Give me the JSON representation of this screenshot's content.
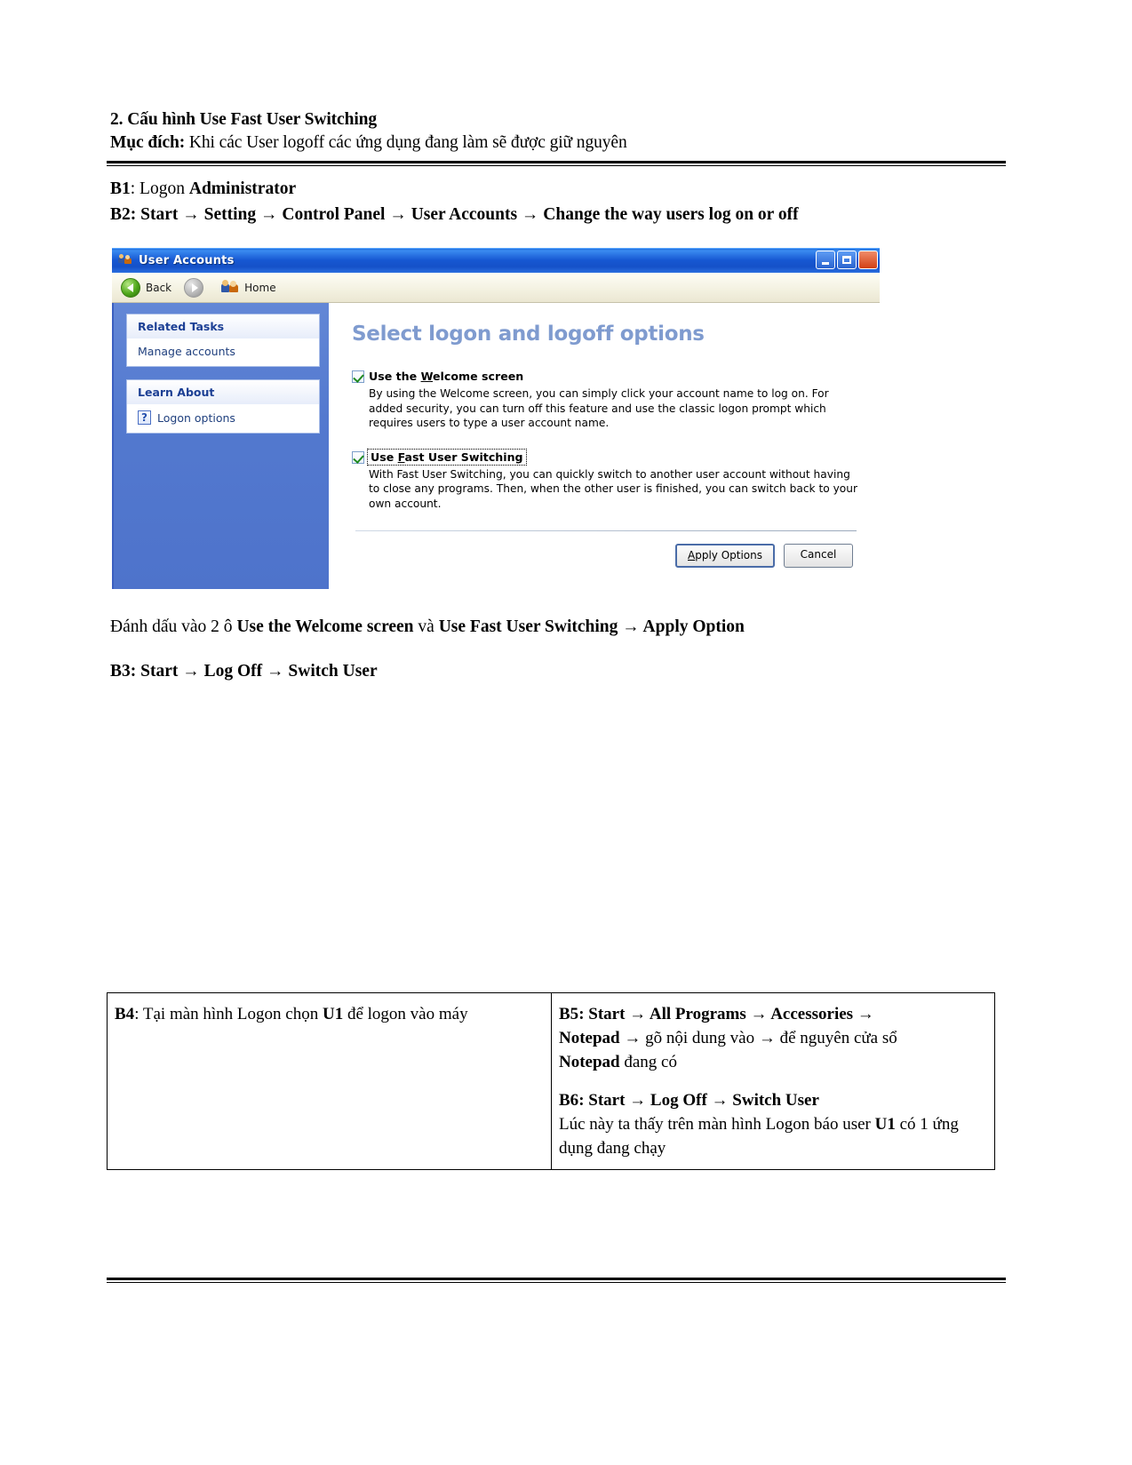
{
  "document": {
    "heading_title": "2. Cấu hình Use Fast User Switching",
    "heading_purpose_label": "Mục đích:",
    "heading_purpose_text": " Khi các User logoff các ứng dụng đang làm sẽ được giữ nguyên",
    "steps": {
      "b1_label": "B1",
      "b1_text": ": Logon ",
      "b1_bold": "Administrator",
      "b2_label": "B2",
      "b2_text": ": Start → Setting → Control Panel → User Accounts → Change the way users log on or off"
    },
    "caption_paragraph": {
      "lead": "Đánh dấu vào 2 ô ",
      "bold1": "Use the Welcome screen",
      "mid": " và ",
      "bold2": "Use Fast User Switching → Apply Option"
    },
    "step_b3": {
      "label": "B3",
      "text": ": Start → Log Off → Switch User"
    }
  },
  "xp_window": {
    "title": "User Accounts",
    "title_icon": "users-icon",
    "caption_buttons": [
      {
        "name": "minimize-button",
        "icon": "minimize-icon"
      },
      {
        "name": "maximize-button",
        "icon": "maximize-icon"
      },
      {
        "name": "close-button",
        "icon": "close-icon"
      }
    ],
    "toolbar": {
      "back_label": "Back",
      "back_icon": "back-arrow-icon",
      "forward_icon": "forward-arrow-icon",
      "home_label": "Home",
      "home_icon": "home-users-icon"
    },
    "sidebar": {
      "related_tasks_header": "Related Tasks",
      "related_tasks_items": [
        {
          "label": "Manage accounts"
        }
      ],
      "learn_about_header": "Learn About",
      "learn_about_items": [
        {
          "label": "Logon options",
          "icon": "question-mark-icon"
        }
      ]
    },
    "main": {
      "title": "Select logon and logoff options",
      "options": [
        {
          "checked": true,
          "label_pre": "Use the ",
          "label_accel": "W",
          "label_post": "elcome screen",
          "description": "By using the Welcome screen, you can simply click your account name to log on. For added security, you can turn off this feature and use the classic logon prompt which requires users to type a user account name."
        },
        {
          "checked": true,
          "focused": true,
          "label_pre": "Use ",
          "label_accel": "F",
          "label_post": "ast User Switching",
          "description": "With Fast User Switching, you can quickly switch to another user account without having to close any programs. Then, when the other user is finished, you can switch back to your own account."
        }
      ],
      "buttons": {
        "apply_accel": "A",
        "apply_pre": "",
        "apply_post": "pply Options",
        "cancel_label": "Cancel"
      }
    }
  },
  "table": {
    "cell_b4": {
      "label": "B4",
      "pre": ": Tại màn hình Logon chọn ",
      "bold": "U1",
      "post": " để logon vào máy"
    },
    "cell_b5": {
      "label": "B5",
      "line1_bold": ":  Start → All Programs → Accessories →",
      "line2_bold1": "Notepad",
      "line2_mid": " → gõ nội dung vào → để nguyên cửa sổ",
      "line3_bold": "Notepad",
      "line3_post": " đang có",
      "b6_label": "B6",
      "b6_bold": ": Start → Log Off → Switch User",
      "b6_desc1": "Lúc này ta thấy trên màn hình Logon báo user ",
      "b6_desc_bold": "U1",
      "b6_desc2": " có 1 ứng dụng đang chạy"
    }
  }
}
